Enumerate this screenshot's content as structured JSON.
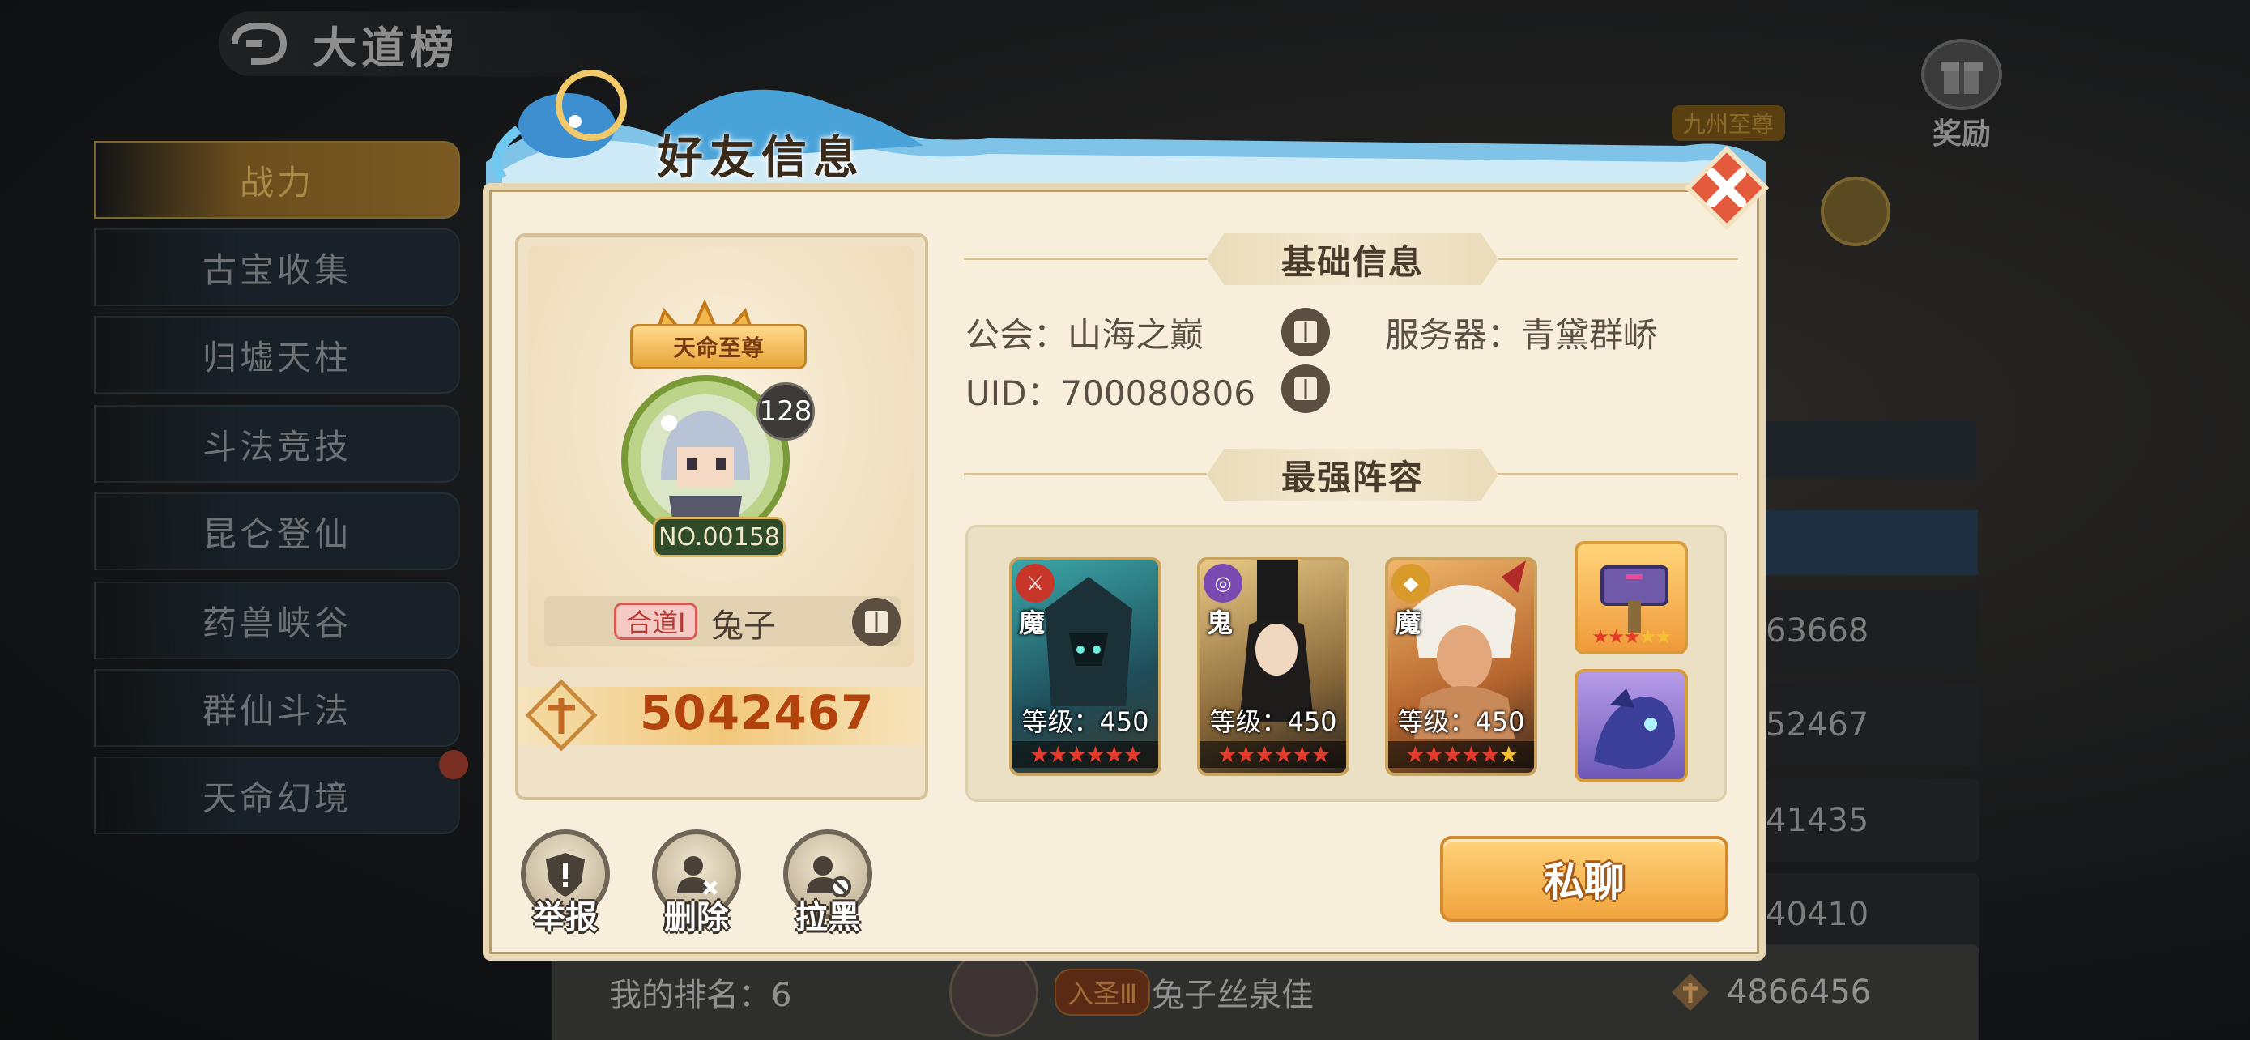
{
  "background": {
    "title": "大道榜",
    "sidebar": [
      "战力",
      "古宝收集",
      "归墟天柱",
      "斗法竞技",
      "昆仑登仙",
      "药兽峡谷",
      "群仙斗法",
      "天命幻境"
    ],
    "reward_label": "奖励",
    "rank_emblem": "九州至尊",
    "ranking_values": [
      "63668",
      "52467",
      "41435",
      "40410"
    ],
    "my_rank_label": "我的排名：6",
    "my_realm": "入圣Ⅲ",
    "my_name": "兔子丝泉佳",
    "my_power": "4866456"
  },
  "modal": {
    "title": "好友信息",
    "card": {
      "title_badge": "天命至尊",
      "level": "128",
      "number": "NO.00158",
      "realm": "合道Ⅰ",
      "name": "兔子",
      "power": "5042467"
    },
    "basic_info": {
      "header": "基础信息",
      "guild": "公会：山海之巅",
      "server": "服务器：青黛群峤",
      "uid": "UID：700080806"
    },
    "lineup": {
      "header": "最强阵容",
      "heroes": [
        {
          "race": "魔",
          "level": "等级：450",
          "stars": "★★★★★★",
          "gold_stars": ""
        },
        {
          "race": "鬼",
          "level": "等级：450",
          "stars": "★★★★★★",
          "gold_stars": ""
        },
        {
          "race": "魔",
          "level": "等级：450",
          "stars": "★★★★★",
          "gold_stars": "★"
        }
      ],
      "artifact_stars": {
        "red": "★★★",
        "gold": "★★"
      }
    },
    "actions": {
      "report": "举报",
      "delete": "删除",
      "block": "拉黑",
      "chat": "私聊"
    }
  },
  "colors": {
    "modal_bg": "#f7eedb",
    "power_text": "#b2430d",
    "chat_button": "#f1a43d",
    "realm_tag": "#d65b54"
  }
}
